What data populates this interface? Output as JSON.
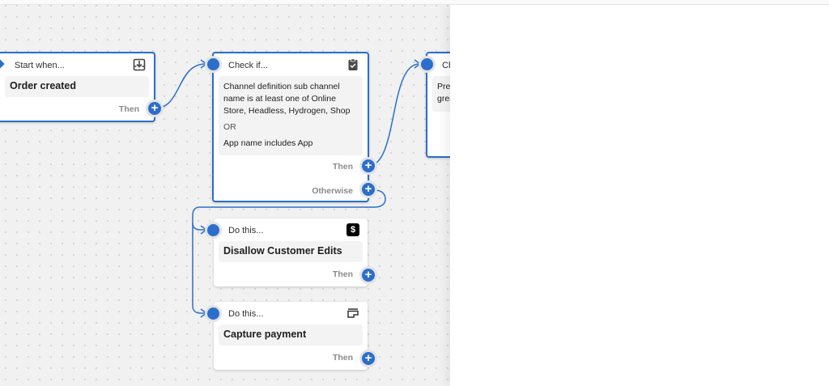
{
  "nodes": {
    "start": {
      "header": "Start when...",
      "title": "Order created",
      "then": "Then",
      "icon": "download-box-icon"
    },
    "check": {
      "header": "Check if...",
      "line1": "Channel definition sub channel name is at least one of Online Store, Headless, Hydrogen, Shop",
      "or": "OR",
      "line2": "App name includes App",
      "then": "Then",
      "otherwise": "Otherwise",
      "icon": "clipboard-check-icon"
    },
    "check2": {
      "header": "Ch",
      "line1": "Pre",
      "line2": "grea"
    },
    "action1": {
      "header": "Do this...",
      "title": "Disallow Customer Edits",
      "then": "Then",
      "icon": "dollar-icon"
    },
    "action2": {
      "header": "Do this...",
      "title": "Capture payment",
      "then": "Then",
      "icon": "card-capture-icon"
    }
  },
  "plus_symbol": "+",
  "colors": {
    "accent": "#2c6ecb",
    "canvas": "#f1f1f1"
  }
}
